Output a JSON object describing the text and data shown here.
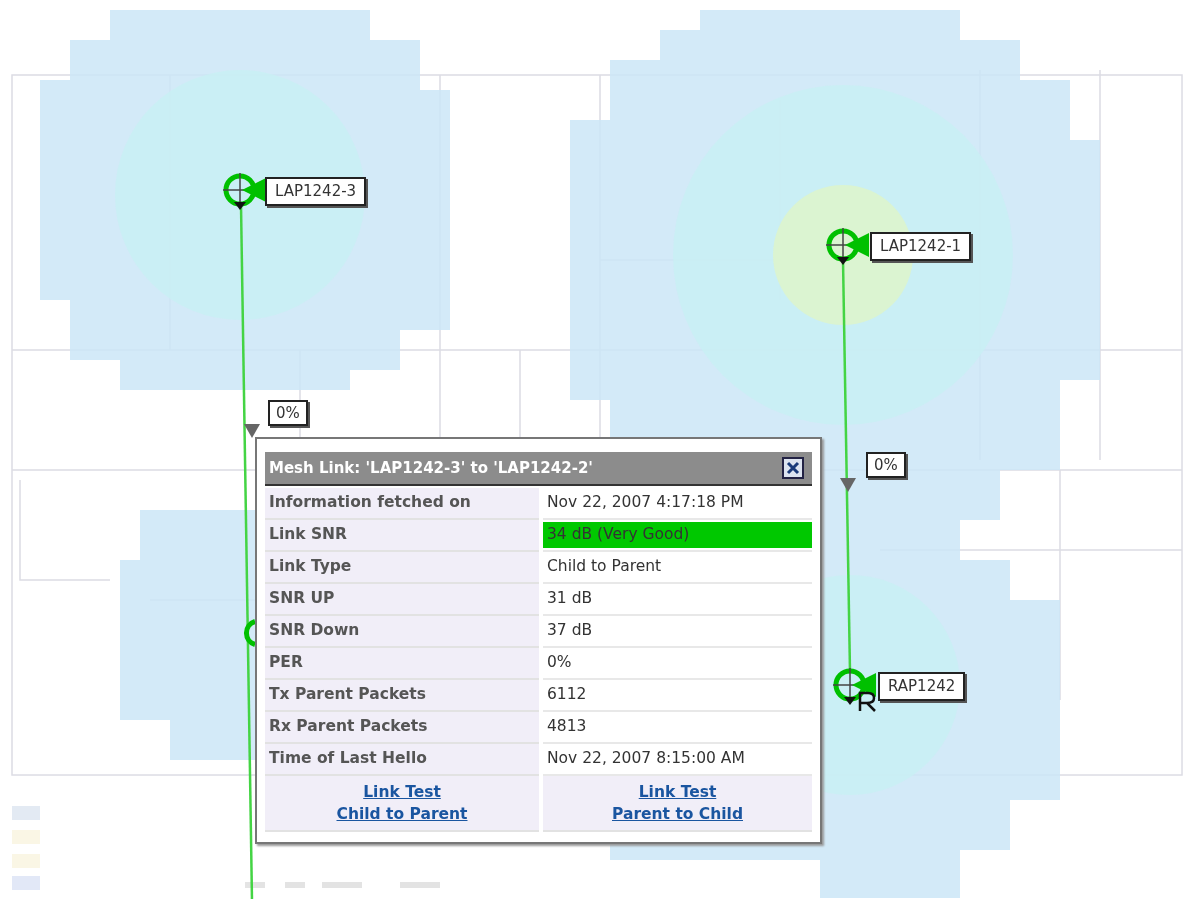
{
  "access_points": [
    {
      "name": "LAP1242-3",
      "kind": "lap"
    },
    {
      "name": "LAP1242-1",
      "kind": "lap"
    },
    {
      "name": "RAP1242",
      "kind": "rap"
    }
  ],
  "links": [
    {
      "label": "0%"
    },
    {
      "label": "0%"
    }
  ],
  "popup": {
    "title": "Mesh Link: 'LAP1242-3' to 'LAP1242-2'",
    "rows": [
      {
        "label": "Information fetched on",
        "value": "Nov 22, 2007 4:17:18 PM"
      },
      {
        "label": "Link SNR",
        "value": "34 dB (Very Good)",
        "color": "#00c800"
      },
      {
        "label": "Link Type",
        "value": "Child to Parent"
      },
      {
        "label": "SNR UP",
        "value": "31 dB"
      },
      {
        "label": "SNR Down",
        "value": "37 dB"
      },
      {
        "label": "PER",
        "value": "0%"
      },
      {
        "label": "Tx Parent Packets",
        "value": "6112"
      },
      {
        "label": "Rx Parent Packets",
        "value": "4813"
      },
      {
        "label": "Time of Last Hello",
        "value": "Nov 22, 2007 8:15:00 AM"
      }
    ],
    "actions": [
      {
        "lines": [
          "Link Test",
          "Child to Parent"
        ]
      },
      {
        "lines": [
          "Link Test",
          "Parent to Child"
        ]
      }
    ]
  }
}
